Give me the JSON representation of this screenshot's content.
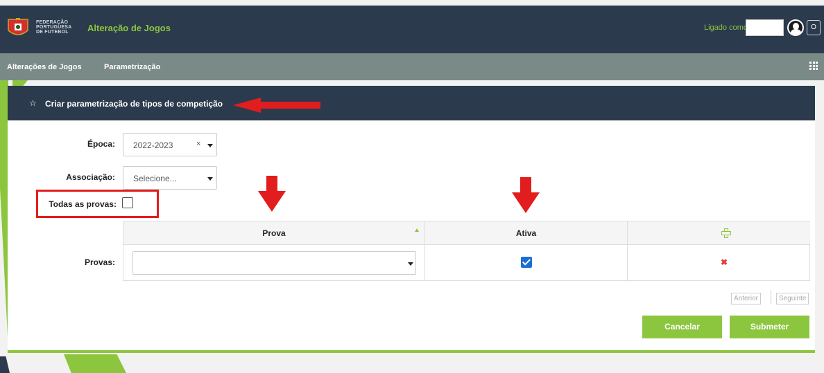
{
  "header": {
    "logo_lines": [
      "FEDERAÇÃO",
      "PORTUGUESA",
      "DE FUTEBOL"
    ],
    "app_title": "Alteração de Jogos",
    "logged_as_label": "Ligado como:",
    "user_value": "",
    "logout_label": "O"
  },
  "nav": {
    "items": [
      {
        "label": "Alterações de Jogos"
      },
      {
        "label": "Parametrização"
      }
    ],
    "apps_icon": "grid-icon"
  },
  "panel": {
    "icon": "star-icon",
    "title": "Criar parametrização de tipos de competição"
  },
  "form": {
    "epoca_label": "Época:",
    "epoca_value": "2022-2023",
    "clear_symbol": "×",
    "associacao_label": "Associação:",
    "associacao_placeholder": "Selecione...",
    "todas_provas_label": "Todas as provas:",
    "todas_provas_checked": false,
    "provas_label": "Provas:"
  },
  "table": {
    "columns": [
      "Prova",
      "Ativa"
    ],
    "add_icon": "plus-icon",
    "rows": [
      {
        "prova": "",
        "ativa": true,
        "delete_icon": "delete-icon"
      }
    ],
    "delete_symbol": "✖"
  },
  "pagination": {
    "previous": "Anterior",
    "next": "Seguinte"
  },
  "buttons": {
    "cancel": "Cancelar",
    "submit": "Submeter"
  },
  "colors": {
    "dark_navy": "#2b3a4c",
    "nav_gray": "#7a8a86",
    "accent_green": "#8cc63f",
    "annotation_red": "#e21d1d",
    "checkbox_blue": "#1b6fd1"
  }
}
